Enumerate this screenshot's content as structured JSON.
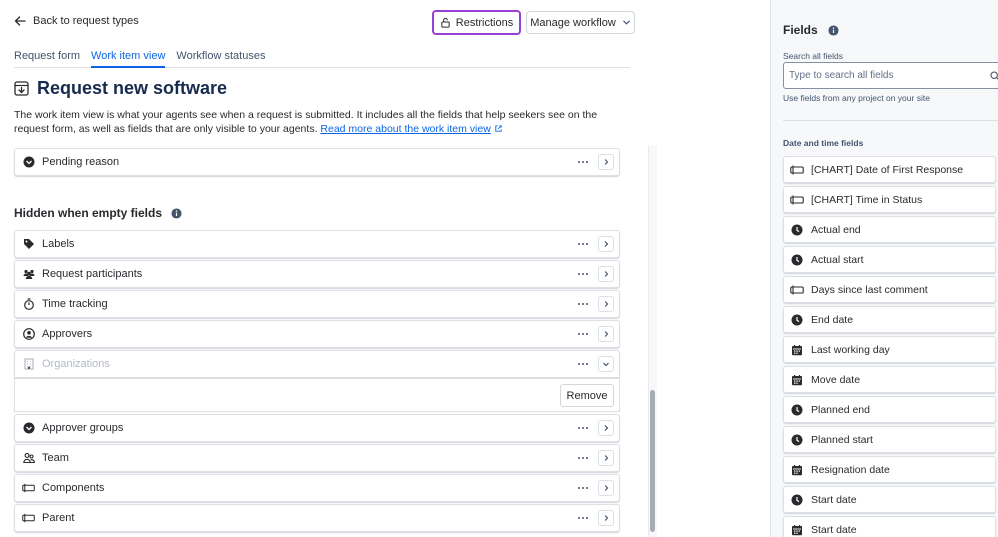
{
  "header": {
    "back_label": "Back to request types",
    "restrictions_label": "Restrictions",
    "workflow_label": "Manage workflow"
  },
  "tabs": [
    {
      "label": "Request form",
      "active": false
    },
    {
      "label": "Work item view",
      "active": true
    },
    {
      "label": "Workflow statuses",
      "active": false
    }
  ],
  "page": {
    "title": "Request new software",
    "description": "The work item view is what your agents see when a request is submitted. It includes all the fields that help seekers see on the request form, as well as fields that are only visible to your agents. ",
    "read_more": "Read more about the work item view"
  },
  "top_row": {
    "label": "Pending reason",
    "icon": "chevron-circle-icon"
  },
  "hidden_section": {
    "title": "Hidden when empty fields",
    "rows": [
      {
        "label": "Labels",
        "icon": "tag-icon"
      },
      {
        "label": "Request participants",
        "icon": "people-group-icon"
      },
      {
        "label": "Time tracking",
        "icon": "stopwatch-icon"
      },
      {
        "label": "Approvers",
        "icon": "person-circle-icon"
      },
      {
        "label": "Organizations",
        "icon": "building-icon",
        "disabled": true,
        "expanded": true
      },
      {
        "label": "Approver groups",
        "icon": "chevron-circle-icon"
      },
      {
        "label": "Team",
        "icon": "people-icon"
      },
      {
        "label": "Components",
        "icon": "textfield-icon"
      },
      {
        "label": "Parent",
        "icon": "textfield-icon"
      }
    ],
    "remove_label": "Remove"
  },
  "fields_panel": {
    "title": "Fields",
    "search_label": "Search all fields",
    "search_placeholder": "Type to search all fields",
    "search_help": "Use fields from any project on your site",
    "group_title": "Date and time fields",
    "items": [
      {
        "label": "[CHART] Date of First Response",
        "icon": "textfield-icon"
      },
      {
        "label": "[CHART] Time in Status",
        "icon": "textfield-icon"
      },
      {
        "label": "Actual end",
        "icon": "clock-icon"
      },
      {
        "label": "Actual start",
        "icon": "clock-icon"
      },
      {
        "label": "Days since last comment",
        "icon": "textfield-icon"
      },
      {
        "label": "End date",
        "icon": "clock-icon"
      },
      {
        "label": "Last working day",
        "icon": "calendar-icon"
      },
      {
        "label": "Move date",
        "icon": "calendar-icon"
      },
      {
        "label": "Planned end",
        "icon": "clock-icon"
      },
      {
        "label": "Planned start",
        "icon": "clock-icon"
      },
      {
        "label": "Resignation date",
        "icon": "calendar-icon"
      },
      {
        "label": "Start date",
        "icon": "clock-icon"
      },
      {
        "label": "Start date",
        "icon": "calendar-icon"
      }
    ]
  },
  "colors": {
    "accent": "#0c66e4",
    "restrictions_border": "#9a3fd6",
    "text": "#292a2e"
  }
}
